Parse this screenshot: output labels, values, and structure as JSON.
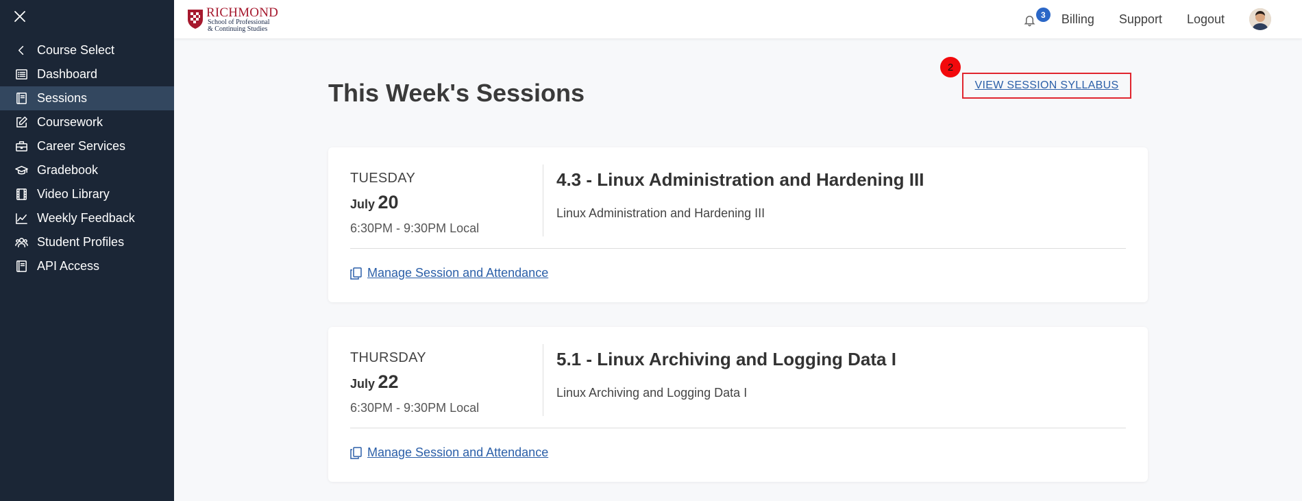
{
  "sidebar": {
    "close_icon": "close-icon",
    "items": [
      {
        "label": "Course Select",
        "icon": "chevron-left-icon"
      },
      {
        "label": "Dashboard",
        "icon": "list-icon"
      },
      {
        "label": "Sessions",
        "icon": "book-icon",
        "active": true
      },
      {
        "label": "Coursework",
        "icon": "edit-icon"
      },
      {
        "label": "Career Services",
        "icon": "briefcase-icon"
      },
      {
        "label": "Gradebook",
        "icon": "graduation-cap-icon"
      },
      {
        "label": "Video Library",
        "icon": "film-icon"
      },
      {
        "label": "Weekly Feedback",
        "icon": "chart-line-icon"
      },
      {
        "label": "Student Profiles",
        "icon": "users-icon"
      },
      {
        "label": "API Access",
        "icon": "book-icon"
      }
    ]
  },
  "header": {
    "logo_main": "RICHMOND",
    "logo_sub1": "School of Professional",
    "logo_sub2": "& Continuing Studies",
    "notification_count": "3",
    "billing": "Billing",
    "support": "Support",
    "logout": "Logout"
  },
  "main": {
    "title": "This Week's Sessions",
    "syllabus_link": "VIEW SESSION SYLLABUS",
    "marker": "2",
    "sessions": [
      {
        "day": "TUESDAY",
        "month": "July",
        "date": "20",
        "time": "6:30PM - 9:30PM Local",
        "title": "4.3 - Linux Administration and Hardening III",
        "description": "Linux Administration and Hardening III",
        "manage": "Manage Session and Attendance"
      },
      {
        "day": "THURSDAY",
        "month": "July",
        "date": "22",
        "time": "6:30PM - 9:30PM Local",
        "title": "5.1 - Linux Archiving and Logging Data I",
        "description": "Linux Archiving and Logging Data I",
        "manage": "Manage Session and Attendance"
      }
    ]
  },
  "colors": {
    "sidebar_bg": "#1b2636",
    "sidebar_active": "#33475f",
    "link": "#2b5fa8",
    "highlight_border": "#e0252e",
    "badge": "#2b67c7",
    "brand_red": "#a6192e"
  }
}
